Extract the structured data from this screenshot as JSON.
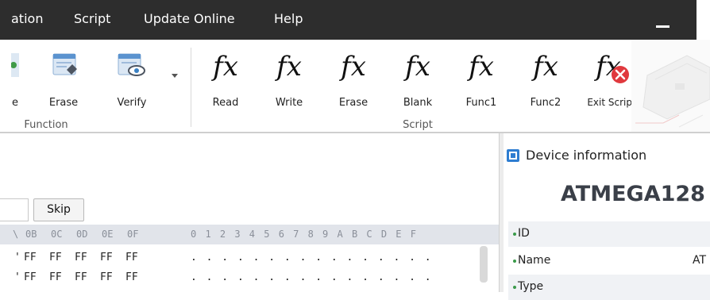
{
  "menu": {
    "items": [
      {
        "label": "ation"
      },
      {
        "label": "Script"
      },
      {
        "label": "Update Online"
      },
      {
        "label": "Help"
      }
    ]
  },
  "ribbon": {
    "function_group": {
      "label": "Function",
      "buttons": [
        {
          "label": "e",
          "icon": "program-icon"
        },
        {
          "label": "Erase",
          "icon": "erase-chip-icon"
        },
        {
          "label": "Verify",
          "icon": "verify-eye-icon"
        }
      ],
      "dropdown_icon": "chevron-down-icon"
    },
    "script_group": {
      "label": "Script",
      "buttons": [
        {
          "label": "Read",
          "icon": "fx-icon"
        },
        {
          "label": "Write",
          "icon": "fx-icon"
        },
        {
          "label": "Erase",
          "icon": "fx-icon"
        },
        {
          "label": "Blank",
          "icon": "fx-icon"
        },
        {
          "label": "Func1",
          "icon": "fx-icon"
        },
        {
          "label": "Func2",
          "icon": "fx-icon"
        },
        {
          "label": "Exit Script",
          "icon": "fx-exit-icon"
        }
      ],
      "fx_glyph": "fx"
    }
  },
  "hex_view": {
    "skip_label": "Skip",
    "offset_value": "",
    "header_hex": [
      "0B",
      "0C",
      "0D",
      "0E",
      "0F"
    ],
    "header_ascii": "0 1 2 3 4 5 6 7 8 9 A B C D E F",
    "header_lead": "\\",
    "rows": [
      {
        "lead": "'",
        "bytes": [
          "FF",
          "FF",
          "FF",
          "FF",
          "FF"
        ],
        "ascii": ". . . . . . . . . . . . . . . ."
      },
      {
        "lead": "'",
        "bytes": [
          "FF",
          "FF",
          "FF",
          "FF",
          "FF"
        ],
        "ascii": ". . . . . . . . . . . . . . . ."
      }
    ]
  },
  "device_info": {
    "title": "Device information",
    "device_name": "ATMEGA128",
    "rows": [
      {
        "label": "ID",
        "value": ""
      },
      {
        "label": "Name",
        "value": "AT"
      },
      {
        "label": "Type",
        "value": ""
      }
    ]
  },
  "colors": {
    "menubar": "#2d2d2d",
    "hex_header": "#e1e4ea",
    "exit_badge": "#e0393e",
    "accent_blue": "#3b82c4"
  }
}
